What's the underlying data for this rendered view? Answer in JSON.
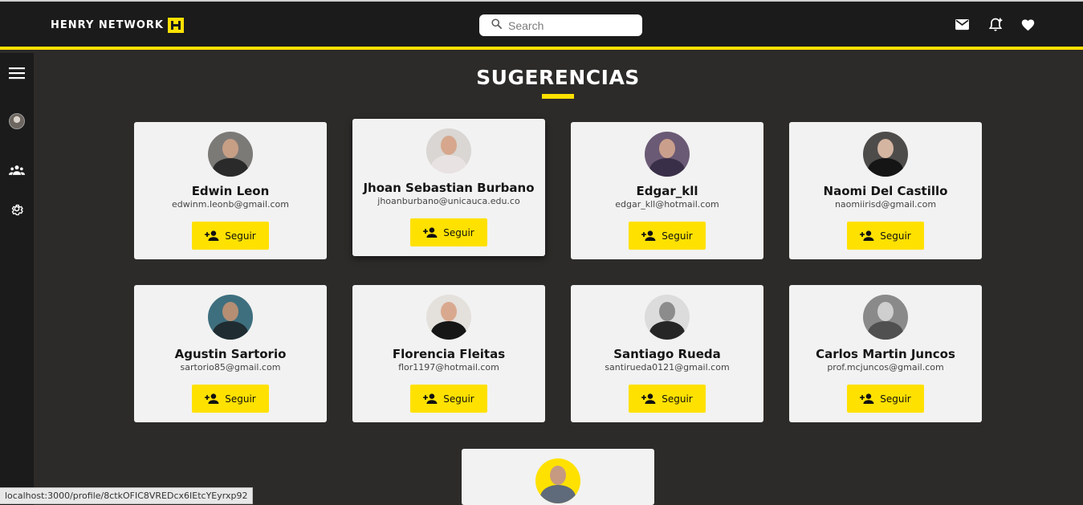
{
  "header": {
    "brand": "HENRY NETWORK",
    "search_placeholder": "Search"
  },
  "page_title": "SUGERENCIAS",
  "follow_label": "Seguir",
  "suggestions": [
    {
      "name": "Edwin Leon",
      "email": "edwinm.leonb@gmail.com",
      "avatar_bg": "#7c7a77",
      "skin": "#c79f85",
      "clothes": "#2a2a2a"
    },
    {
      "name": "Jhoan Sebastian Burbano",
      "email": "jhoanburbano@unicauca.edu.co",
      "avatar_bg": "#d9d6d3",
      "skin": "#d6a78d",
      "clothes": "#e9e2e2"
    },
    {
      "name": "Edgar_kll",
      "email": "edgar_kll@hotmail.com",
      "avatar_bg": "#6b5a75",
      "skin": "#caa08c",
      "clothes": "#3a2f48"
    },
    {
      "name": "Naomi Del Castillo",
      "email": "naomiirisd@gmail.com",
      "avatar_bg": "#4e4c4a",
      "skin": "#d4b5a1",
      "clothes": "#151515"
    },
    {
      "name": "Agustin Sartorio",
      "email": "sartorio85@gmail.com",
      "avatar_bg": "#3e6f7f",
      "skin": "#b58e74",
      "clothes": "#1f2c31"
    },
    {
      "name": "Florencia Fleitas",
      "email": "flor1197@hotmail.com",
      "avatar_bg": "#e4e0dc",
      "skin": "#d9a98f",
      "clothes": "#161616"
    },
    {
      "name": "Santiago Rueda",
      "email": "santirueda0121@gmail.com",
      "avatar_bg": "#dcdcdc",
      "skin": "#8c8c8c",
      "clothes": "#262626"
    },
    {
      "name": "Carlos Martin Juncos",
      "email": "prof.mcjuncos@gmail.com",
      "avatar_bg": "#8a8a8a",
      "skin": "#cfcfcf",
      "clothes": "#505050"
    },
    {
      "name": "",
      "email": "",
      "avatar_bg": "#ffe100",
      "skin": "#c69a80",
      "clothes": "#5f6a7a"
    }
  ],
  "status_url": "localhost:3000/profile/8ctkOFIC8VREDcx6IEtcYEyrxp92",
  "colors": {
    "accent": "#ffe100",
    "bg": "#2d2b29",
    "bar": "#1b1b1b",
    "card": "#f2f2f2"
  },
  "icons": [
    "search-icon",
    "mail-icon",
    "notification-add-icon",
    "heart-icon",
    "menu-icon",
    "profile-avatar",
    "group-icon",
    "settings-icon",
    "person-add-icon"
  ]
}
